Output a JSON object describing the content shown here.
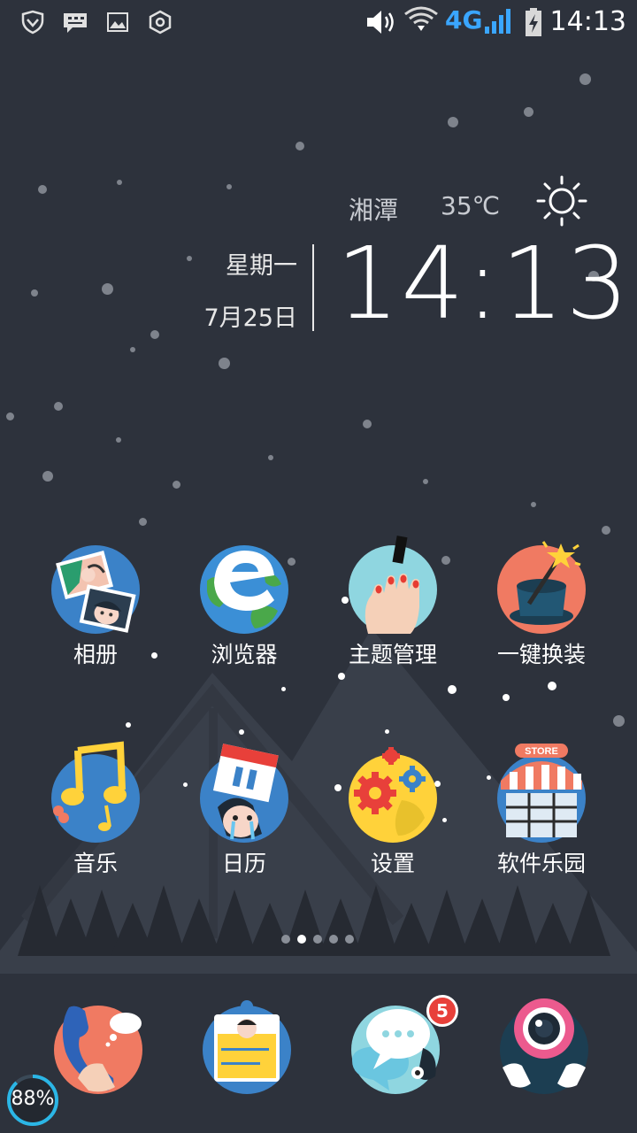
{
  "status_bar": {
    "time": "14:13",
    "network": "4G",
    "icons": [
      "shield-icon",
      "chat-icon",
      "image-icon",
      "settings-hex-icon",
      "volume-icon",
      "wifi-icon",
      "signal-icon",
      "battery-charging-icon"
    ]
  },
  "widget": {
    "city": "湘潭",
    "temperature": "35℃",
    "weather_icon": "sun-icon",
    "weekday": "星期一",
    "date": "7月25日",
    "time": "14:13"
  },
  "apps": [
    {
      "label": "相册",
      "icon": "photo-album-icon"
    },
    {
      "label": "浏览器",
      "icon": "browser-icon"
    },
    {
      "label": "主题管理",
      "icon": "theme-icon"
    },
    {
      "label": "一键换装",
      "icon": "magic-hat-icon"
    },
    {
      "label": "音乐",
      "icon": "music-icon"
    },
    {
      "label": "日历",
      "icon": "calendar-icon"
    },
    {
      "label": "设置",
      "icon": "settings-gears-icon"
    },
    {
      "label": "软件乐园",
      "icon": "store-icon"
    }
  ],
  "pager": {
    "count": 5,
    "active": 2
  },
  "dock": [
    {
      "icon": "phone-icon"
    },
    {
      "icon": "contacts-icon"
    },
    {
      "icon": "messages-icon",
      "badge": "5"
    },
    {
      "icon": "camera-icon"
    }
  ],
  "boost": {
    "percent": "88%",
    "level": 0.88
  },
  "colors": {
    "background": "#2d323c",
    "accent": "#3aa6ff",
    "badge": "#e8403a"
  }
}
